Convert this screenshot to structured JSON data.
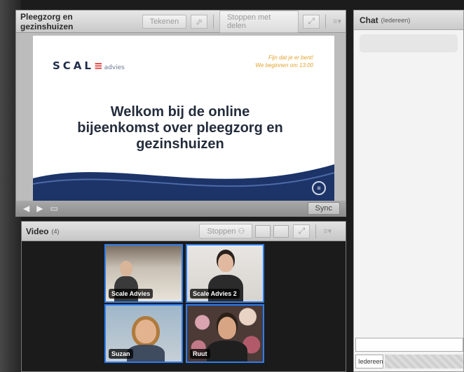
{
  "share_pod": {
    "title": "Pleegzorg en gezinshuizen",
    "draw_label": "Tekenen",
    "pointer_icon": "pointer-icon",
    "stop_sharing_label": "Stoppen met delen",
    "fullscreen_icon": "fullscreen-icon",
    "menu_icon": "menu-icon",
    "sync_label": "Sync"
  },
  "slide": {
    "logo_text": "SCAL",
    "logo_suffix": "advies",
    "note_line1": "Fijn dat je er bent!",
    "note_line2": "We beginnen om 13:00",
    "title": "Welkom bij de online bijeenkomst over pleegzorg en gezinshuizen",
    "brand_color": "#1e2d4a",
    "accent_color": "#e0a330"
  },
  "chat_pod": {
    "title": "Chat",
    "audience": "(Iedereen)",
    "recipient": "Iedereen"
  },
  "video_pod": {
    "title": "Video",
    "count": "(4)",
    "stop_label": "Stoppen",
    "tiles": [
      {
        "name": "Scale Advies"
      },
      {
        "name": "Scale Advies 2"
      },
      {
        "name": "Suzan"
      },
      {
        "name": "Ruut"
      }
    ]
  },
  "colors": {
    "active_tile_border": "#2d7df0",
    "slide_wave": "#1c3468"
  }
}
